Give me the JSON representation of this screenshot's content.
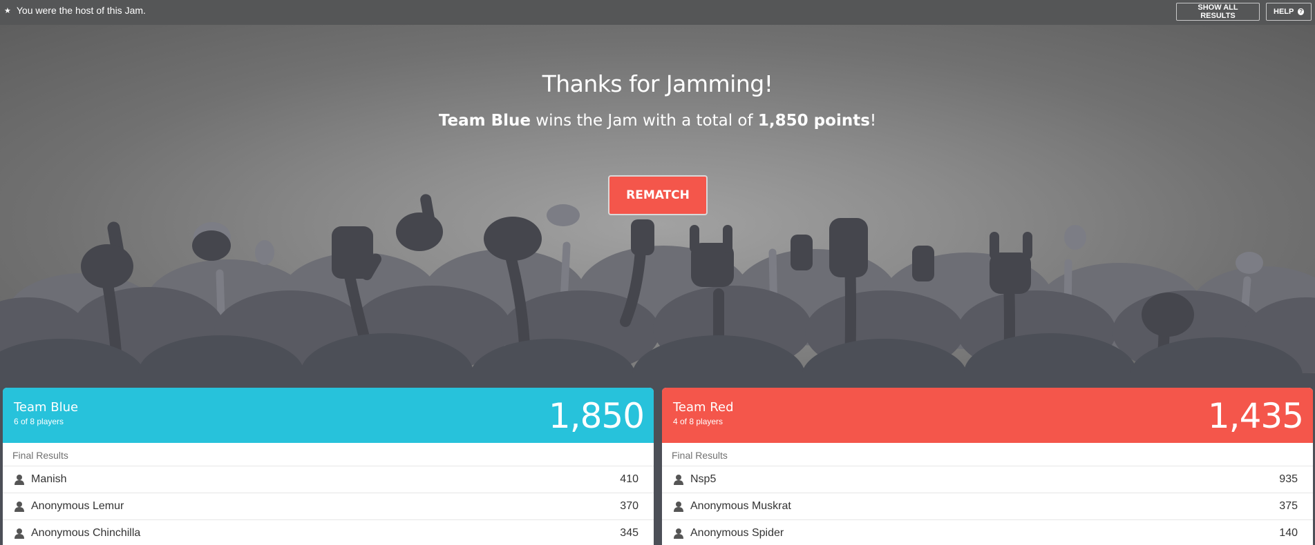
{
  "topbar": {
    "host_message": "You were the host of this Jam.",
    "show_all_results_label": "SHOW ALL RESULTS",
    "help_label": "HELP"
  },
  "hero": {
    "title": "Thanks for Jamming!",
    "winner_team": "Team Blue",
    "winner_middle": " wins the Jam with a total of ",
    "winner_points": "1,850 points",
    "winner_end": "!",
    "rematch_label": "REMATCH"
  },
  "teams": [
    {
      "name": "Team Blue",
      "players": "6 of 8 players",
      "score": "1,850",
      "color": "#27c2db",
      "results_label": "Final Results",
      "rows": [
        {
          "name": "Manish",
          "score": "410"
        },
        {
          "name": "Anonymous Lemur",
          "score": "370"
        },
        {
          "name": "Anonymous Chinchilla",
          "score": "345"
        }
      ]
    },
    {
      "name": "Team Red",
      "players": "4 of 8 players",
      "score": "1,435",
      "color": "#f4564b",
      "results_label": "Final Results",
      "rows": [
        {
          "name": "Nsp5",
          "score": "935"
        },
        {
          "name": "Anonymous Muskrat",
          "score": "375"
        },
        {
          "name": "Anonymous Spider",
          "score": "140"
        }
      ]
    }
  ],
  "icons": {
    "host": "star-icon",
    "help": "question-circle-icon",
    "player": "person-icon"
  }
}
